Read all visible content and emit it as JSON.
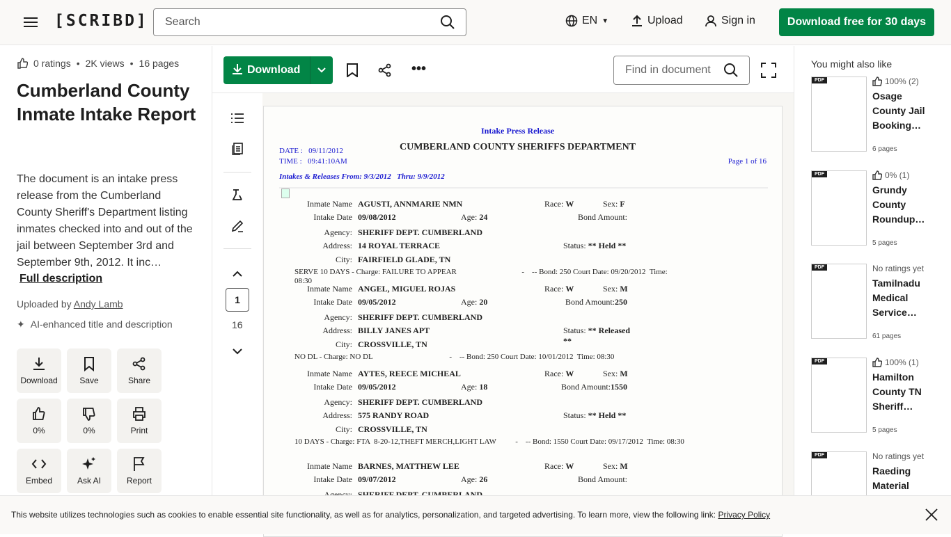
{
  "header": {
    "logo": "[SCRIBD]",
    "search_placeholder": "Search",
    "language": "EN",
    "upload": "Upload",
    "sign_in": "Sign in",
    "cta": "Download free for 30 days"
  },
  "doc_info": {
    "ratings": "0 ratings",
    "views": "2K views",
    "pages": "16 pages",
    "title": "Cumberland County Inmate Intake Report",
    "description": "The document is an intake press release from the Cumberland County Sheriff's Department listing inmates checked into and out of the jail between September 3rd and September 9th, 2012. It inc…",
    "full_description": "Full description",
    "uploaded_by": "Uploaded by",
    "uploader": "Andy Lamb",
    "ai_note": "AI-enhanced title and description"
  },
  "actions": [
    {
      "label": "Download",
      "icon": "download"
    },
    {
      "label": "Save",
      "icon": "bookmark"
    },
    {
      "label": "Share",
      "icon": "share"
    },
    {
      "label": "0%",
      "icon": "thumbs-up"
    },
    {
      "label": "0%",
      "icon": "thumbs-down"
    },
    {
      "label": "Print",
      "icon": "print"
    },
    {
      "label": "Embed",
      "icon": "code"
    },
    {
      "label": "Ask AI",
      "icon": "sparkle"
    },
    {
      "label": "Report",
      "icon": "flag"
    }
  ],
  "toolbar": {
    "download": "Download",
    "find_placeholder": "Find in document"
  },
  "pager": {
    "current": "1",
    "total": "16"
  },
  "document": {
    "header_title": "Intake Press Release",
    "department": "CUMBERLAND COUNTY SHERIFFS DEPARTMENT",
    "date_label": "DATE :",
    "date": "09/11/2012",
    "time_label": "TIME :",
    "time": "09:41:10AM",
    "page": "Page 1 of 16",
    "range": "Intakes & Releases From: 9/3/2012   Thru: 9/9/2012",
    "labels": {
      "name": "Inmate Name",
      "intake": "Intake Date",
      "agency": "Agency:",
      "address": "Address:",
      "city": "City:",
      "race": "Race:",
      "sex": "Sex:",
      "age": "Age:",
      "bond": "Bond Amount:",
      "status": "Status:"
    },
    "records": [
      {
        "name": "AGUSTI, ANNMARIE NMN",
        "race": "W",
        "sex": "F",
        "intake": "09/08/2012",
        "age": "24",
        "bond": "",
        "agency": "SHERIFF DEPT. CUMBERLAND",
        "address": "14 ROYAL TERRACE",
        "status": "** Held **",
        "city": "FAIRFIELD GLADE, TN",
        "charge": "SERVE 10 DAYS - Charge: FAILURE TO APPEAR                                  -    -- Bond: 250 Court Date: 09/20/2012  Time: 08:30"
      },
      {
        "name": "ANGEL, MIGUEL ROJAS",
        "race": "W",
        "sex": "M",
        "intake": "09/05/2012",
        "age": "20",
        "bond": "250",
        "agency": "SHERIFF DEPT. CUMBERLAND",
        "address": "BILLY JANES APT",
        "status": "** Released **",
        "city": "CROSSVILLE, TN",
        "charge": "NO DL - Charge: NO DL                                        -    -- Bond: 250 Court Date: 10/01/2012  Time: 08:30"
      },
      {
        "name": "AYTES, REECE MICHEAL",
        "race": "W",
        "sex": "M",
        "intake": "09/05/2012",
        "age": "18",
        "bond": "1550",
        "agency": "SHERIFF DEPT. CUMBERLAND",
        "address": "575 RANDY ROAD",
        "status": "** Held **",
        "city": "CROSSVILLE, TN",
        "charge": "10 DAYS - Charge: FTA  8-20-12,THEFT MERCH,LIGHT LAW          -    -- Bond: 1550 Court Date: 09/17/2012  Time: 08:30"
      },
      {
        "name": "BARNES, MATTHEW LEE",
        "race": "W",
        "sex": "M",
        "intake": "09/07/2012",
        "age": "26",
        "bond": "",
        "agency": "SHERIFF DEPT. CUMBERLAND",
        "address": "",
        "status": "",
        "city": "",
        "charge": ""
      }
    ]
  },
  "related": {
    "heading": "You might also like",
    "items": [
      {
        "rating": "100% (2)",
        "title": "Osage County Jail Booking…",
        "pages": "6 pages",
        "badge": "PDF"
      },
      {
        "rating": "0% (1)",
        "title": "Grundy County Roundup…",
        "pages": "5 pages",
        "badge": "PDF"
      },
      {
        "rating": "No ratings yet",
        "title": "Tamilnadu Medical Service…",
        "pages": "61 pages",
        "badge": "PDF"
      },
      {
        "rating": "100% (1)",
        "title": "Hamilton County TN Sheriff…",
        "pages": "5 pages",
        "badge": "PDF"
      },
      {
        "rating": "No ratings yet",
        "title": "Raeding Material",
        "pages": "",
        "badge": "PDF"
      }
    ]
  },
  "cookie": {
    "text": "This website utilizes technologies such as cookies to enable essential site functionality, as well as for analytics, personalization, and targeted advertising. To learn more, view the following link:",
    "link": "Privacy Policy"
  }
}
